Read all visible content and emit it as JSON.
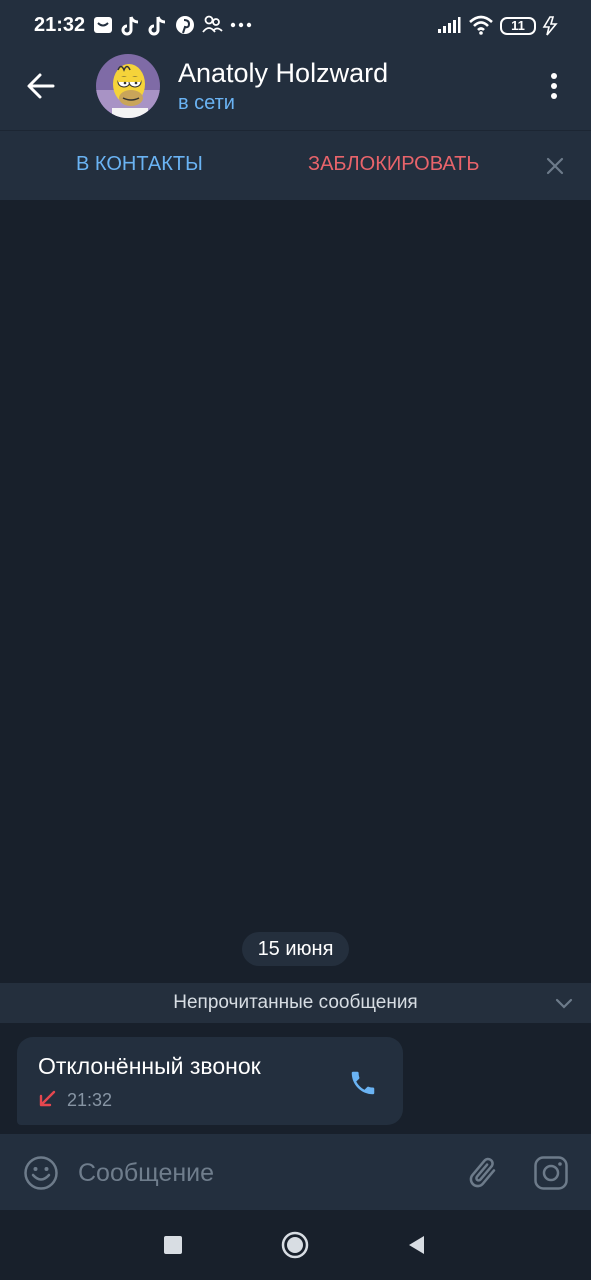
{
  "status_bar": {
    "time": "21:32",
    "battery": "11",
    "notification_icons": [
      "mail-icon",
      "tiktok-icon",
      "tiktok-icon",
      "pinterest-icon",
      "people-icon",
      "more-dots-icon"
    ]
  },
  "header": {
    "contact_name": "Anatoly Holzward",
    "contact_status": "в сети"
  },
  "action_bar": {
    "add_contact_label": "В КОНТАКТЫ",
    "block_label": "ЗАБЛОКИРОВАТЬ"
  },
  "chat": {
    "date_label": "15 июня",
    "unread_label": "Непрочитанные сообщения",
    "messages": [
      {
        "title": "Отклонённый звонок",
        "time": "21:32"
      }
    ]
  },
  "composer": {
    "placeholder": "Сообщение"
  },
  "colors": {
    "accent": "#6ab3f3",
    "danger": "#e8646b",
    "header_bg": "#232f3e",
    "chat_bg": "#18202b"
  }
}
